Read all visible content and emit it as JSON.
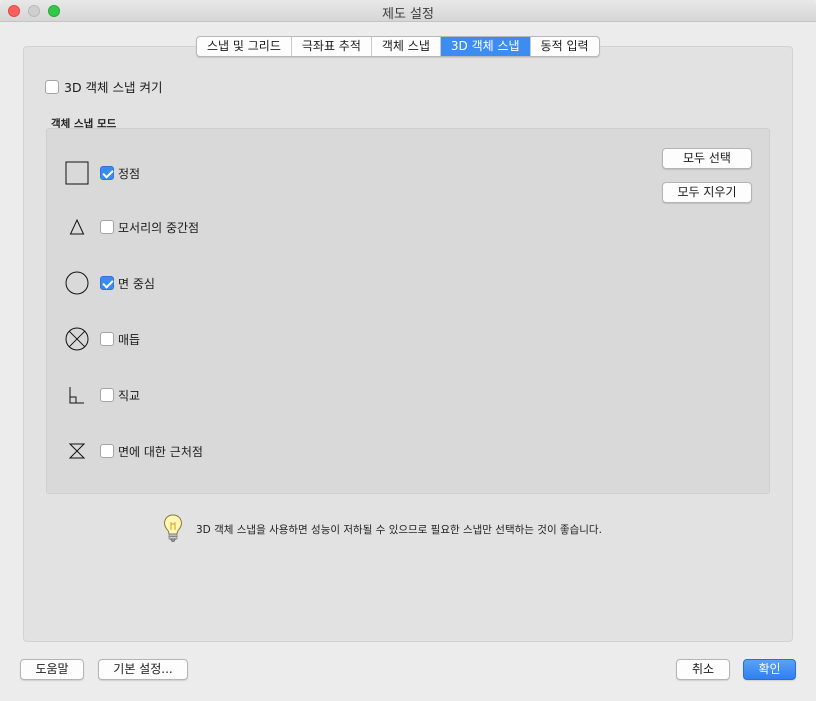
{
  "window": {
    "title": "제도 설정"
  },
  "tabs": [
    {
      "label": "스냅 및 그리드",
      "active": false
    },
    {
      "label": "극좌표 추적",
      "active": false
    },
    {
      "label": "객체 스냅",
      "active": false
    },
    {
      "label": "3D 객체 스냅",
      "active": true
    },
    {
      "label": "동적 입력",
      "active": false
    }
  ],
  "enable_3d_snap": {
    "label": "3D 객체 스냅 켜기",
    "checked": false
  },
  "snap_modes": {
    "section_label": "객체 스냅 모드",
    "items": [
      {
        "label": "정점",
        "icon": "vertex-square-icon",
        "checked": true
      },
      {
        "label": "모서리의 중간점",
        "icon": "midpoint-triangle-icon",
        "checked": false
      },
      {
        "label": "면 중심",
        "icon": "center-circle-icon",
        "checked": true
      },
      {
        "label": "매듭",
        "icon": "knot-circle-x-icon",
        "checked": false
      },
      {
        "label": "직교",
        "icon": "perpendicular-icon",
        "checked": false
      },
      {
        "label": "면에 대한 근처점",
        "icon": "nearest-hourglass-icon",
        "checked": false
      }
    ],
    "select_all_label": "모두 선택",
    "clear_all_label": "모두 지우기"
  },
  "hint": {
    "icon": "lightbulb-icon",
    "text": "3D 객체 스냅을 사용하면 성능이 저하될 수 있으므로 필요한 스냅만 선택하는 것이 좋습니다."
  },
  "footer": {
    "help_label": "도움말",
    "defaults_label": "기본 설정...",
    "cancel_label": "취소",
    "ok_label": "확인"
  },
  "colors": {
    "accent": "#3d8cf0",
    "panel": "#e2e2e2",
    "inner_panel": "#d9d9d9"
  }
}
